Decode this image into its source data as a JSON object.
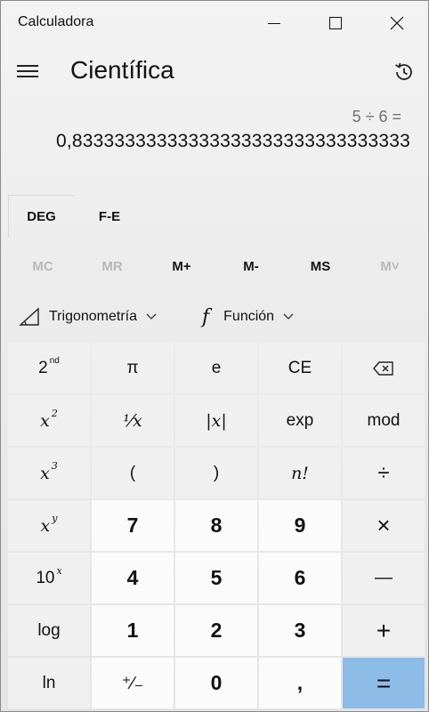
{
  "window": {
    "title": "Calculadora",
    "controls": [
      "minimize-icon",
      "maximize-icon",
      "close-icon"
    ]
  },
  "header": {
    "menu_icon": "hamburger-icon",
    "mode": "Científica",
    "history_icon": "history-icon"
  },
  "display": {
    "expression": "5 ÷ 6 =",
    "value": "0,83333333333333333333333333333333"
  },
  "angle_row": {
    "deg": "DEG",
    "fe": "F-E"
  },
  "memory_row": [
    {
      "label": "MC",
      "enabled": false
    },
    {
      "label": "MR",
      "enabled": false
    },
    {
      "label": "M+",
      "enabled": true
    },
    {
      "label": "M-",
      "enabled": true
    },
    {
      "label": "MS",
      "enabled": true
    },
    {
      "label": "M˅",
      "enabled": false
    }
  ],
  "functions_row": {
    "trig": "Trigonometría",
    "trig_icon": "triangle-icon",
    "func": "Función",
    "func_icon": "f-icon"
  },
  "keys": {
    "second": {
      "base": "2",
      "sup": "nd"
    },
    "pi": "π",
    "e": "e",
    "ce": "CE",
    "backspace": "backspace-icon",
    "x2": {
      "base": "x",
      "sup": "2"
    },
    "reciprocal": "⅟x",
    "abs": "|x|",
    "exp": "exp",
    "mod": "mod",
    "x3": {
      "base": "x",
      "sup": "3"
    },
    "lparen": "(",
    "rparen": ")",
    "factorial": "n!",
    "divide": "÷",
    "xy": {
      "base": "x",
      "sup": "y"
    },
    "n7": "7",
    "n8": "8",
    "n9": "9",
    "multiply": "×",
    "tenx": {
      "base": "10",
      "sup": "x"
    },
    "n4": "4",
    "n5": "5",
    "n6": "6",
    "minus": "—",
    "log": "log",
    "n1": "1",
    "n2": "2",
    "n3": "3",
    "plus": "+",
    "ln": "ln",
    "negate": "⁺∕₋",
    "n0": "0",
    "decimal": ",",
    "equals": "="
  },
  "colors": {
    "equals_bg": "#8dbce6",
    "number_key_bg": "#fbfbfb",
    "function_key_bg": "#f0f0f0",
    "disabled_text": "#b8b8b8"
  }
}
